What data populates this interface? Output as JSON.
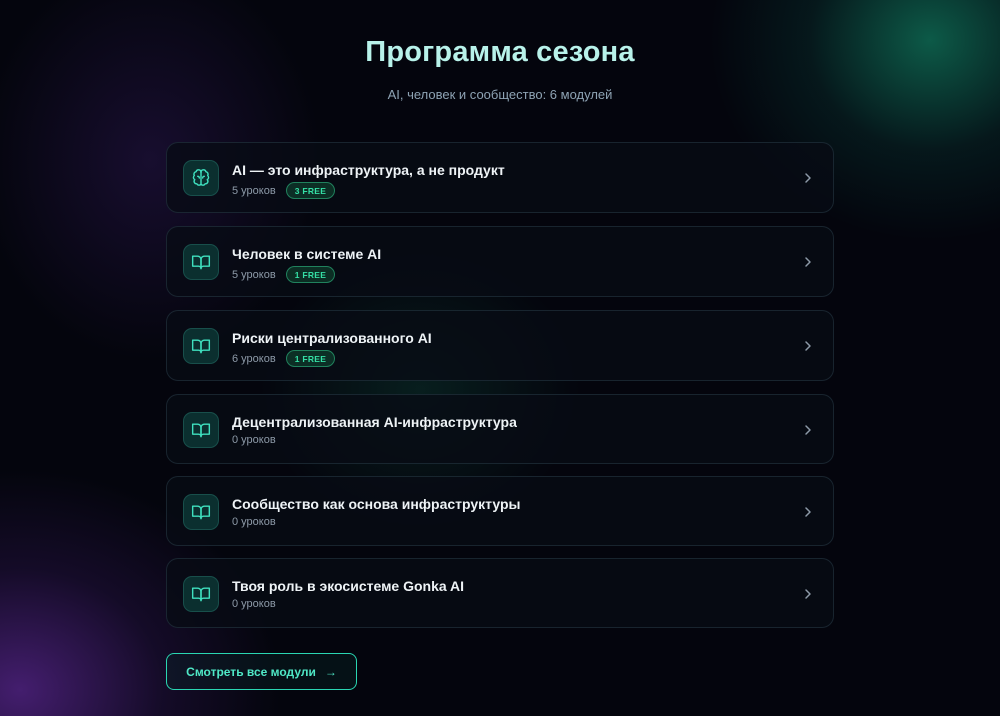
{
  "header": {
    "title": "Программа сезона",
    "subtitle": "AI, человек и сообщество: 6 модулей"
  },
  "modules": [
    {
      "title": "AI — это инфраструктура, а не продукт",
      "lessons": "5 уроков",
      "free": "3 FREE",
      "icon": "brain-icon"
    },
    {
      "title": "Человек в системе AI",
      "lessons": "5 уроков",
      "free": "1 FREE",
      "icon": "book-icon"
    },
    {
      "title": "Риски централизованного AI",
      "lessons": "6 уроков",
      "free": "1 FREE",
      "icon": "book-icon"
    },
    {
      "title": "Децентрализованная AI-инфраструктура",
      "lessons": "0 уроков",
      "free": "",
      "icon": "book-icon"
    },
    {
      "title": "Сообщество как основа инфраструктуры",
      "lessons": "0 уроков",
      "free": "",
      "icon": "book-icon"
    },
    {
      "title": "Твоя роль в экосистеме Gonka AI",
      "lessons": "0 уроков",
      "free": "",
      "icon": "book-icon"
    }
  ],
  "cta": {
    "label": "Смотреть все модули",
    "arrow": "→"
  },
  "colors": {
    "accent": "#2ad6b2",
    "free_badge": "#35e0a6",
    "background": "#04050d"
  }
}
